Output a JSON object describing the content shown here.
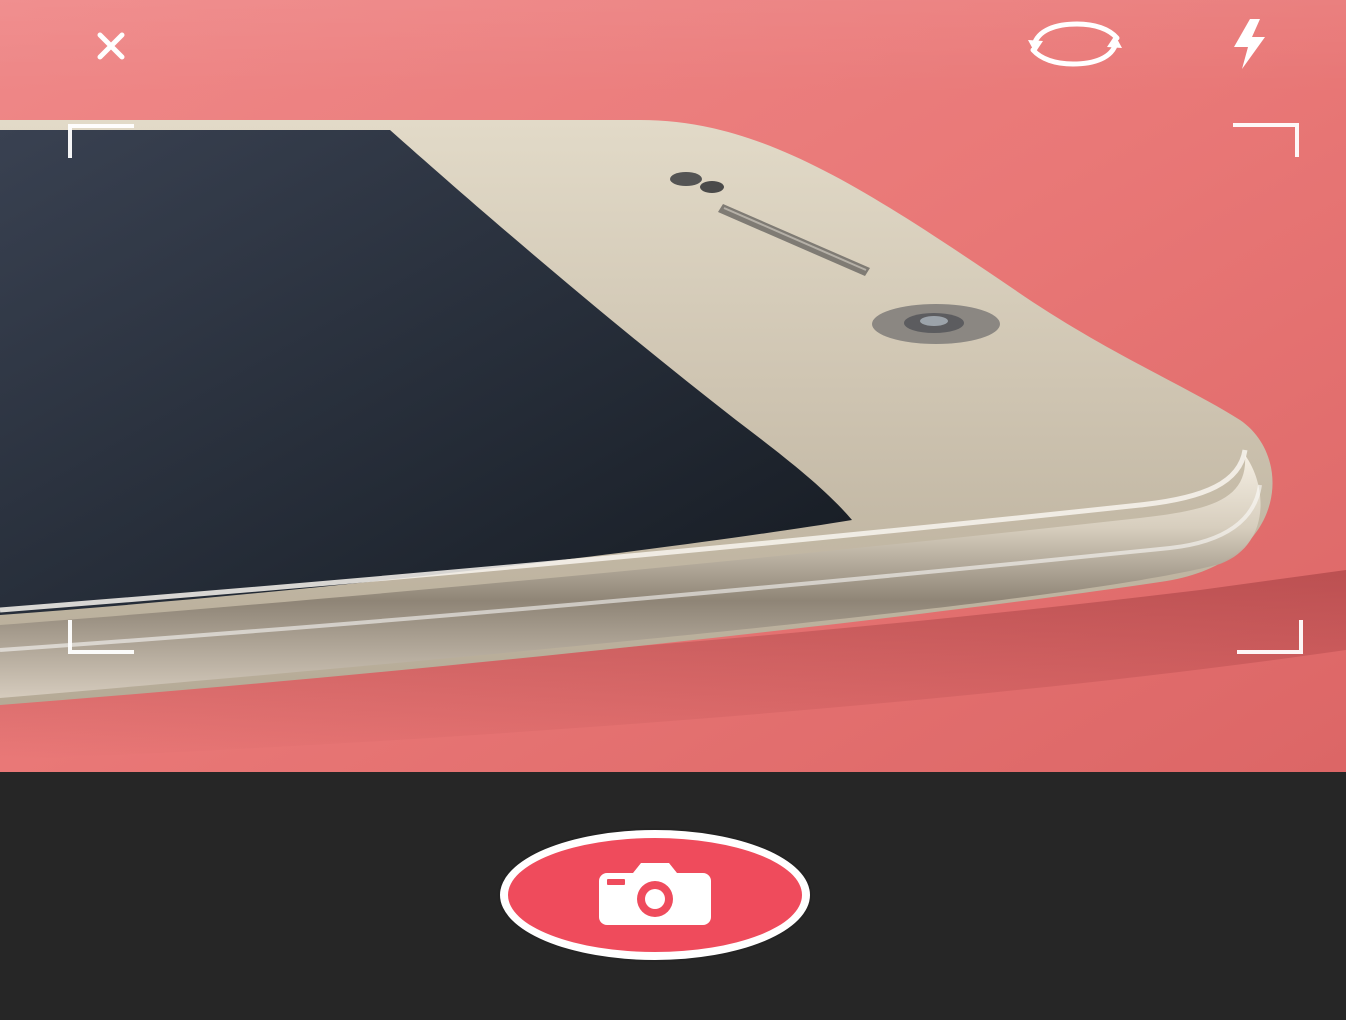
{
  "screen": {
    "type": "camera",
    "accent_color": "#ef4b5c",
    "bottom_bar_color": "#262626",
    "preview_background_color": "#e97b7a"
  },
  "top_bar": {
    "close": {
      "icon": "close-icon"
    },
    "switch_camera": {
      "icon": "switch-camera-icon"
    },
    "flash": {
      "icon": "flash-icon"
    }
  },
  "viewfinder": {
    "focus_frame": {
      "corners": [
        "top-left",
        "top-right",
        "bottom-left",
        "bottom-right"
      ]
    }
  },
  "bottom_bar": {
    "shutter": {
      "icon": "camera-icon"
    }
  }
}
